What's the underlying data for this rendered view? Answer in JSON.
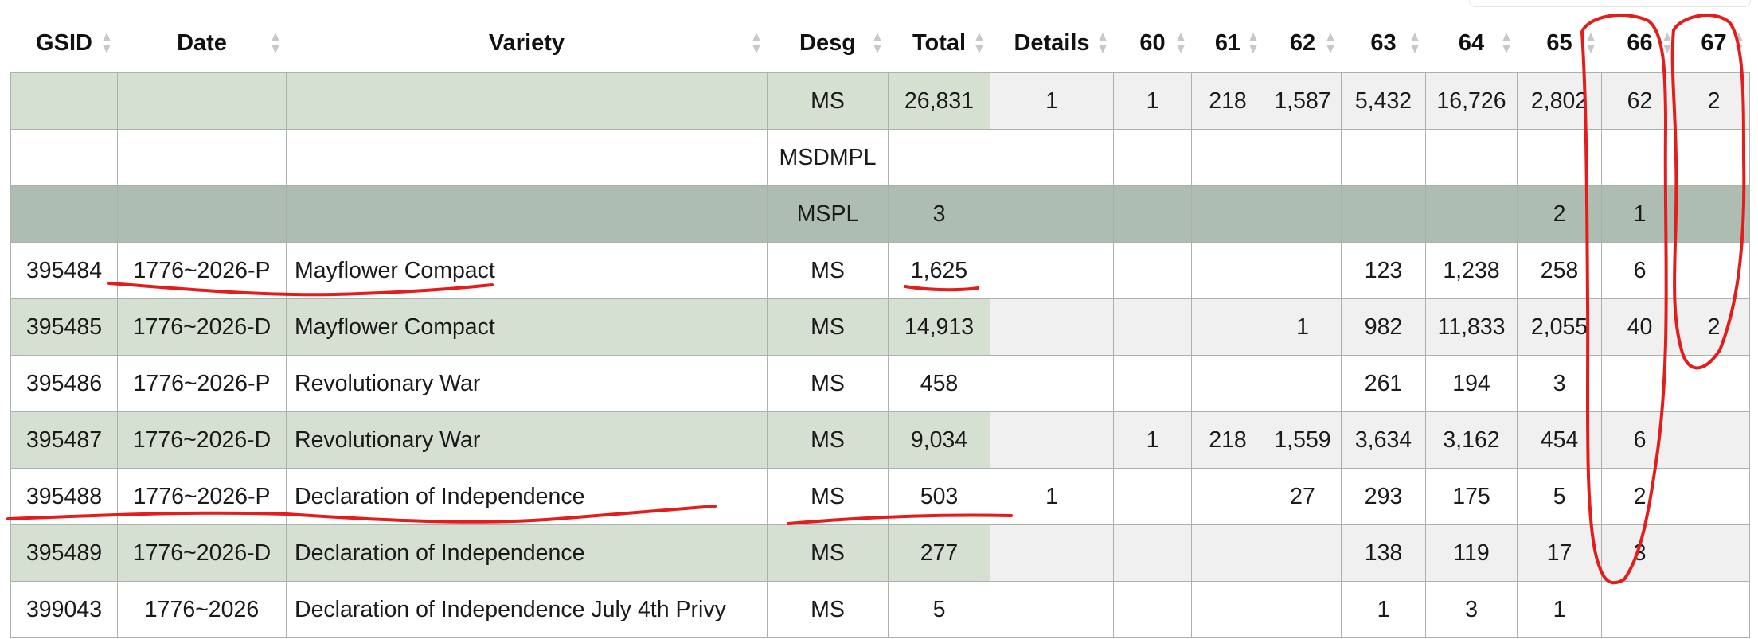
{
  "table": {
    "columns": [
      {
        "label": "GSID"
      },
      {
        "label": "Date"
      },
      {
        "label": "Variety"
      },
      {
        "label": "Desg"
      },
      {
        "label": "Total"
      },
      {
        "label": "Details"
      },
      {
        "label": "60"
      },
      {
        "label": "61"
      },
      {
        "label": "62"
      },
      {
        "label": "63"
      },
      {
        "label": "64"
      },
      {
        "label": "65"
      },
      {
        "label": "66"
      },
      {
        "label": "67"
      }
    ],
    "rows": [
      {
        "style": "green",
        "cells": [
          "",
          "",
          "",
          "MS",
          "26,831",
          "1",
          "1",
          "218",
          "1,587",
          "5,432",
          "16,726",
          "2,802",
          "62",
          "2"
        ]
      },
      {
        "style": "white",
        "cells": [
          "",
          "",
          "",
          "MSDMPL",
          "",
          "",
          "",
          "",
          "",
          "",
          "",
          "",
          "",
          ""
        ]
      },
      {
        "style": "dark",
        "cells": [
          "",
          "",
          "",
          "MSPL",
          "3",
          "",
          "",
          "",
          "",
          "",
          "",
          "2",
          "1",
          ""
        ]
      },
      {
        "style": "white",
        "cells": [
          "395484",
          "1776~2026-P",
          "Mayflower Compact",
          "MS",
          "1,625",
          "",
          "",
          "",
          "",
          "123",
          "1,238",
          "258",
          "6",
          ""
        ]
      },
      {
        "style": "green",
        "cells": [
          "395485",
          "1776~2026-D",
          "Mayflower Compact",
          "MS",
          "14,913",
          "",
          "",
          "",
          "1",
          "982",
          "11,833",
          "2,055",
          "40",
          "2"
        ]
      },
      {
        "style": "white",
        "cells": [
          "395486",
          "1776~2026-P",
          "Revolutionary War",
          "MS",
          "458",
          "",
          "",
          "",
          "",
          "261",
          "194",
          "3",
          "",
          ""
        ]
      },
      {
        "style": "green",
        "cells": [
          "395487",
          "1776~2026-D",
          "Revolutionary War",
          "MS",
          "9,034",
          "",
          "1",
          "218",
          "1,559",
          "3,634",
          "3,162",
          "454",
          "6",
          ""
        ]
      },
      {
        "style": "white",
        "cells": [
          "395488",
          "1776~2026-P",
          "Declaration of Independence",
          "MS",
          "503",
          "1",
          "",
          "",
          "27",
          "293",
          "175",
          "5",
          "2",
          ""
        ]
      },
      {
        "style": "green",
        "cells": [
          "395489",
          "1776~2026-D",
          "Declaration of Independence",
          "MS",
          "277",
          "",
          "",
          "",
          "",
          "138",
          "119",
          "17",
          "3",
          ""
        ]
      },
      {
        "style": "white",
        "cells": [
          "399043",
          "1776~2026",
          "Declaration of Independence July 4th Privy",
          "MS",
          "5",
          "",
          "",
          "",
          "",
          "1",
          "3",
          "1",
          "",
          ""
        ]
      }
    ]
  },
  "colors": {
    "row_green": "#d6e0d2",
    "row_dark": "#aebdb1",
    "row_grey": "#f0f0f0",
    "annotation": "#e31c1c",
    "sort_icon": "#c8c8c8"
  }
}
